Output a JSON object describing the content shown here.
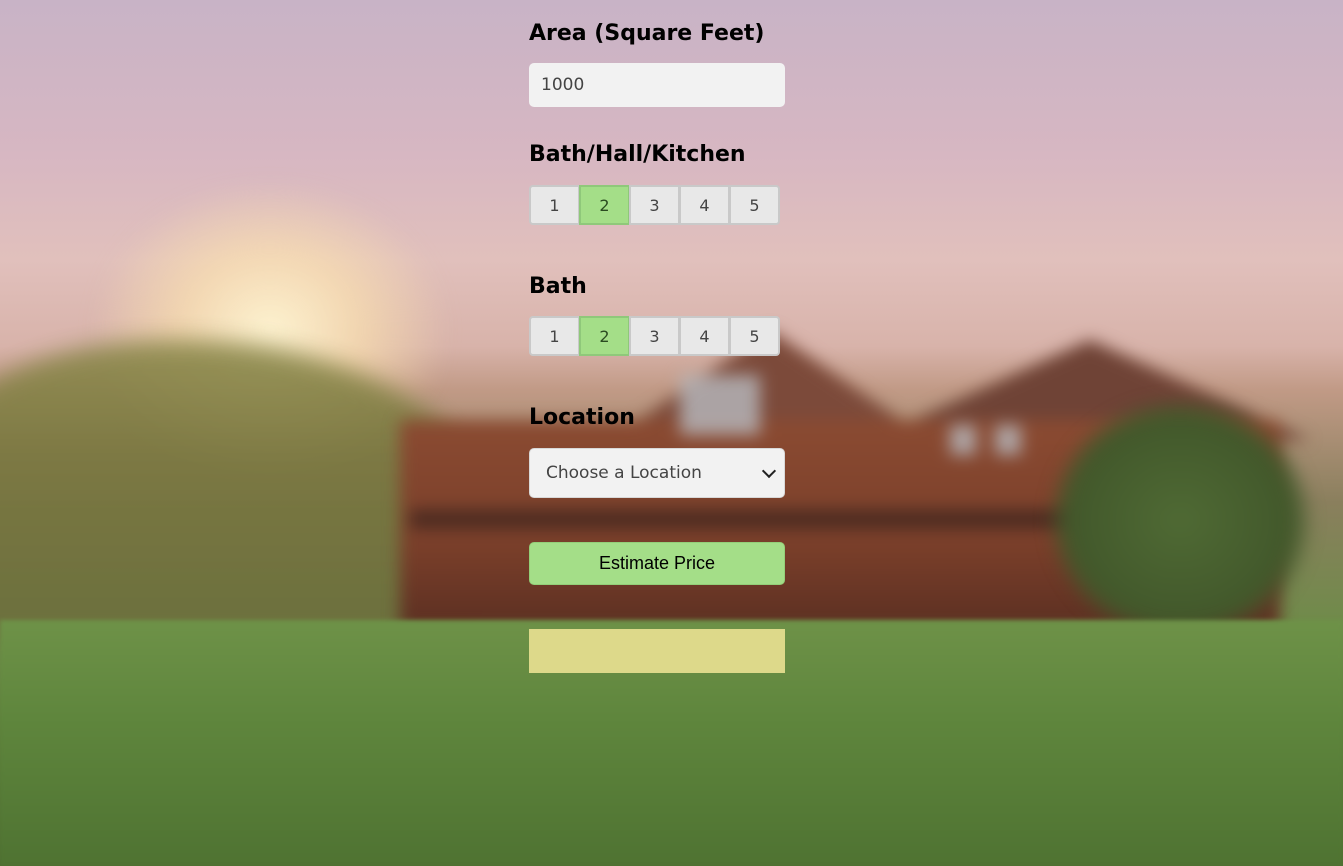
{
  "area": {
    "label": "Area (Square Feet)",
    "value": "1000"
  },
  "bhk": {
    "label": "Bath/Hall/Kitchen",
    "options": [
      "1",
      "2",
      "3",
      "4",
      "5"
    ],
    "selected": "2"
  },
  "bath": {
    "label": "Bath",
    "options": [
      "1",
      "2",
      "3",
      "4",
      "5"
    ],
    "selected": "2"
  },
  "location": {
    "label": "Location",
    "selected": "Choose a Location"
  },
  "estimate": {
    "button_label": "Estimate Price",
    "result_text": ""
  },
  "colors": {
    "selected_segment": "#a4de88",
    "button": "#a4de88",
    "result_box": "#ddd98a"
  }
}
